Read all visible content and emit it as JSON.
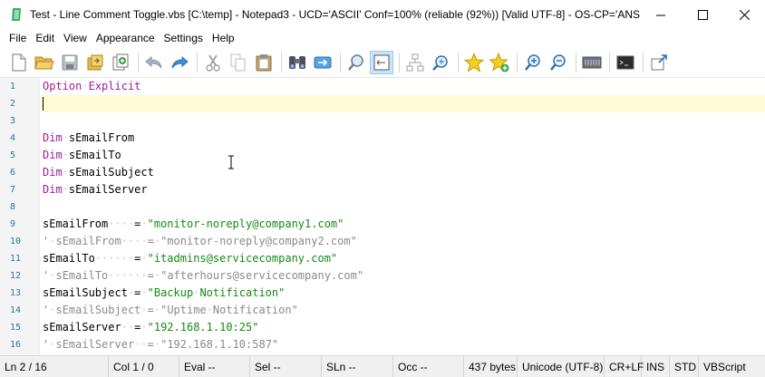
{
  "window": {
    "title": "Test - Line Comment Toggle.vbs [C:\\temp] - Notepad3 - UCD='ASCII' Conf=100% (reliable (92%)) [Valid UTF-8] - OS-CP='ANSI..."
  },
  "menu": [
    "File",
    "Edit",
    "View",
    "Appearance",
    "Settings",
    "Help"
  ],
  "toolbar": {
    "icons": [
      "new-file-icon",
      "open-folder-icon",
      "save-icon",
      "browse-icon",
      "save-copy-icon",
      "undo-icon",
      "redo-icon",
      "cut-icon",
      "copy-icon",
      "paste-icon",
      "find-icon",
      "replace-icon",
      "find-in-files-icon",
      "word-wrap-icon",
      "fold-icon",
      "goto-icon",
      "bookmark-icon",
      "add-bookmark-icon",
      "zoom-in-icon",
      "zoom-out-icon",
      "customize-icon",
      "terminal-icon",
      "pin-icon"
    ]
  },
  "editor": {
    "line_numbers": [
      "1",
      "2",
      "3",
      "4",
      "5",
      "6",
      "7",
      "8",
      "9",
      "10",
      "11",
      "12",
      "13",
      "14",
      "15",
      "16"
    ],
    "lines": [
      {
        "parts": [
          [
            "kw",
            "Option"
          ],
          [
            "ws",
            "·"
          ],
          [
            "kw",
            "Explicit"
          ]
        ]
      },
      {
        "parts": []
      },
      {
        "parts": []
      },
      {
        "parts": [
          [
            "kw",
            "Dim"
          ],
          [
            "ws",
            "·"
          ],
          [
            "pl",
            "sEmailFrom"
          ]
        ]
      },
      {
        "parts": [
          [
            "kw",
            "Dim"
          ],
          [
            "ws",
            "·"
          ],
          [
            "pl",
            "sEmailTo"
          ]
        ]
      },
      {
        "parts": [
          [
            "kw",
            "Dim"
          ],
          [
            "ws",
            "·"
          ],
          [
            "pl",
            "sEmailSubject"
          ]
        ]
      },
      {
        "parts": [
          [
            "kw",
            "Dim"
          ],
          [
            "ws",
            "·"
          ],
          [
            "pl",
            "sEmailServer"
          ]
        ]
      },
      {
        "parts": []
      },
      {
        "parts": [
          [
            "pl",
            "sEmailFrom"
          ],
          [
            "ws",
            "····"
          ],
          [
            "pl",
            "="
          ],
          [
            "ws",
            "·"
          ],
          [
            "str",
            "\"monitor-noreply@company1.com\""
          ]
        ]
      },
      {
        "parts": [
          [
            "cmt",
            "'"
          ],
          [
            "ws",
            "·"
          ],
          [
            "cmt",
            "sEmailFrom"
          ],
          [
            "ws",
            "····"
          ],
          [
            "cmt",
            "="
          ],
          [
            "ws",
            "·"
          ],
          [
            "cmt",
            "\"monitor-noreply@company2.com\""
          ]
        ]
      },
      {
        "parts": [
          [
            "pl",
            "sEmailTo"
          ],
          [
            "ws",
            "······"
          ],
          [
            "pl",
            "="
          ],
          [
            "ws",
            "·"
          ],
          [
            "str",
            "\"itadmins@servicecompany.com\""
          ]
        ]
      },
      {
        "parts": [
          [
            "cmt",
            "'"
          ],
          [
            "ws",
            "·"
          ],
          [
            "cmt",
            "sEmailTo"
          ],
          [
            "ws",
            "······"
          ],
          [
            "cmt",
            "="
          ],
          [
            "ws",
            "·"
          ],
          [
            "cmt",
            "\"afterhours@servicecompany.com\""
          ]
        ]
      },
      {
        "parts": [
          [
            "pl",
            "sEmailSubject"
          ],
          [
            "ws",
            "·"
          ],
          [
            "pl",
            "="
          ],
          [
            "ws",
            "·"
          ],
          [
            "str",
            "\"Backup"
          ],
          [
            "ws",
            "·"
          ],
          [
            "str",
            "Notification\""
          ]
        ]
      },
      {
        "parts": [
          [
            "cmt",
            "'"
          ],
          [
            "ws",
            "·"
          ],
          [
            "cmt",
            "sEmailSubject"
          ],
          [
            "ws",
            "·"
          ],
          [
            "cmt",
            "="
          ],
          [
            "ws",
            "·"
          ],
          [
            "cmt",
            "\"Uptime"
          ],
          [
            "ws",
            "·"
          ],
          [
            "cmt",
            "Notification\""
          ]
        ]
      },
      {
        "parts": [
          [
            "pl",
            "sEmailServer"
          ],
          [
            "ws",
            "··"
          ],
          [
            "pl",
            "="
          ],
          [
            "ws",
            "·"
          ],
          [
            "str",
            "\"192.168.1.10:25\""
          ]
        ]
      },
      {
        "parts": [
          [
            "cmt",
            "'"
          ],
          [
            "ws",
            "·"
          ],
          [
            "cmt",
            "sEmailServer"
          ],
          [
            "ws",
            "··"
          ],
          [
            "cmt",
            "="
          ],
          [
            "ws",
            "·"
          ],
          [
            "cmt",
            "\"192.168.1.10:587\""
          ]
        ]
      },
      {
        "parts": []
      }
    ],
    "colors": {
      "keyword": "#a01a9e",
      "string": "#148a14",
      "comment": "#8a8a8a",
      "current_line": "#fffbd6"
    }
  },
  "status": {
    "ln": "Ln 2 / 16",
    "col": "Col 1 / 0",
    "eval": "Eval --",
    "sel": "Sel --",
    "sln": "SLn --",
    "occ": "Occ --",
    "size": "437 bytes",
    "encoding": "Unicode (UTF-8)",
    "eol": "CR+LF",
    "ins": "INS",
    "std": "STD",
    "lexer": "VBScript"
  }
}
